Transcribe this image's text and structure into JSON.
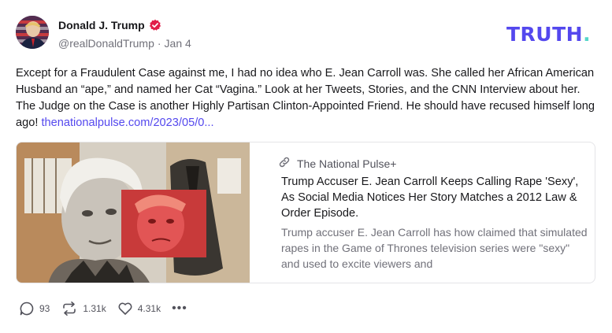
{
  "author": {
    "name": "Donald J. Trump",
    "handle": "@realDonaldTrump",
    "separator": "·",
    "date": "Jan 4"
  },
  "brand": {
    "name": "TRUTH",
    "dot": "."
  },
  "post": {
    "text": "Except for a Fraudulent Case against me, I had no idea who E. Jean Carroll was. She called her African American Husband an “ape,” and named her Cat “Vagina.” Look at her Tweets, Stories, and the CNN Interview about her. The Judge on the Case is another Highly Partisan Clinton-Appointed Friend. He should have recused himself long ago!",
    "link": "thenationalpulse.com/2023/05/0..."
  },
  "card": {
    "source": "The National Pulse+",
    "title": "Trump Accuser E. Jean Carroll Keeps Calling Rape 'Sexy', As Social Media Notices Her Story Matches a 2012 Law & Order Episode.",
    "description": "Trump accuser E. Jean Carroll has how claimed that simulated rapes in the Game of Thrones television series were \"sexy\" and used to excite viewers and"
  },
  "actions": {
    "replies": "93",
    "retruths": "1.31k",
    "likes": "4.31k",
    "more": "•••"
  },
  "icons": {
    "verified": "verified-badge-icon",
    "link": "link-icon",
    "reply": "reply-bubble-icon",
    "retruth": "repost-arrows-icon",
    "like": "heart-icon",
    "more": "more-dots-icon"
  },
  "colors": {
    "brand": "#5448ee",
    "brand_dot": "#55d6c9",
    "verified": "#e11d48",
    "link": "#5448ee"
  }
}
